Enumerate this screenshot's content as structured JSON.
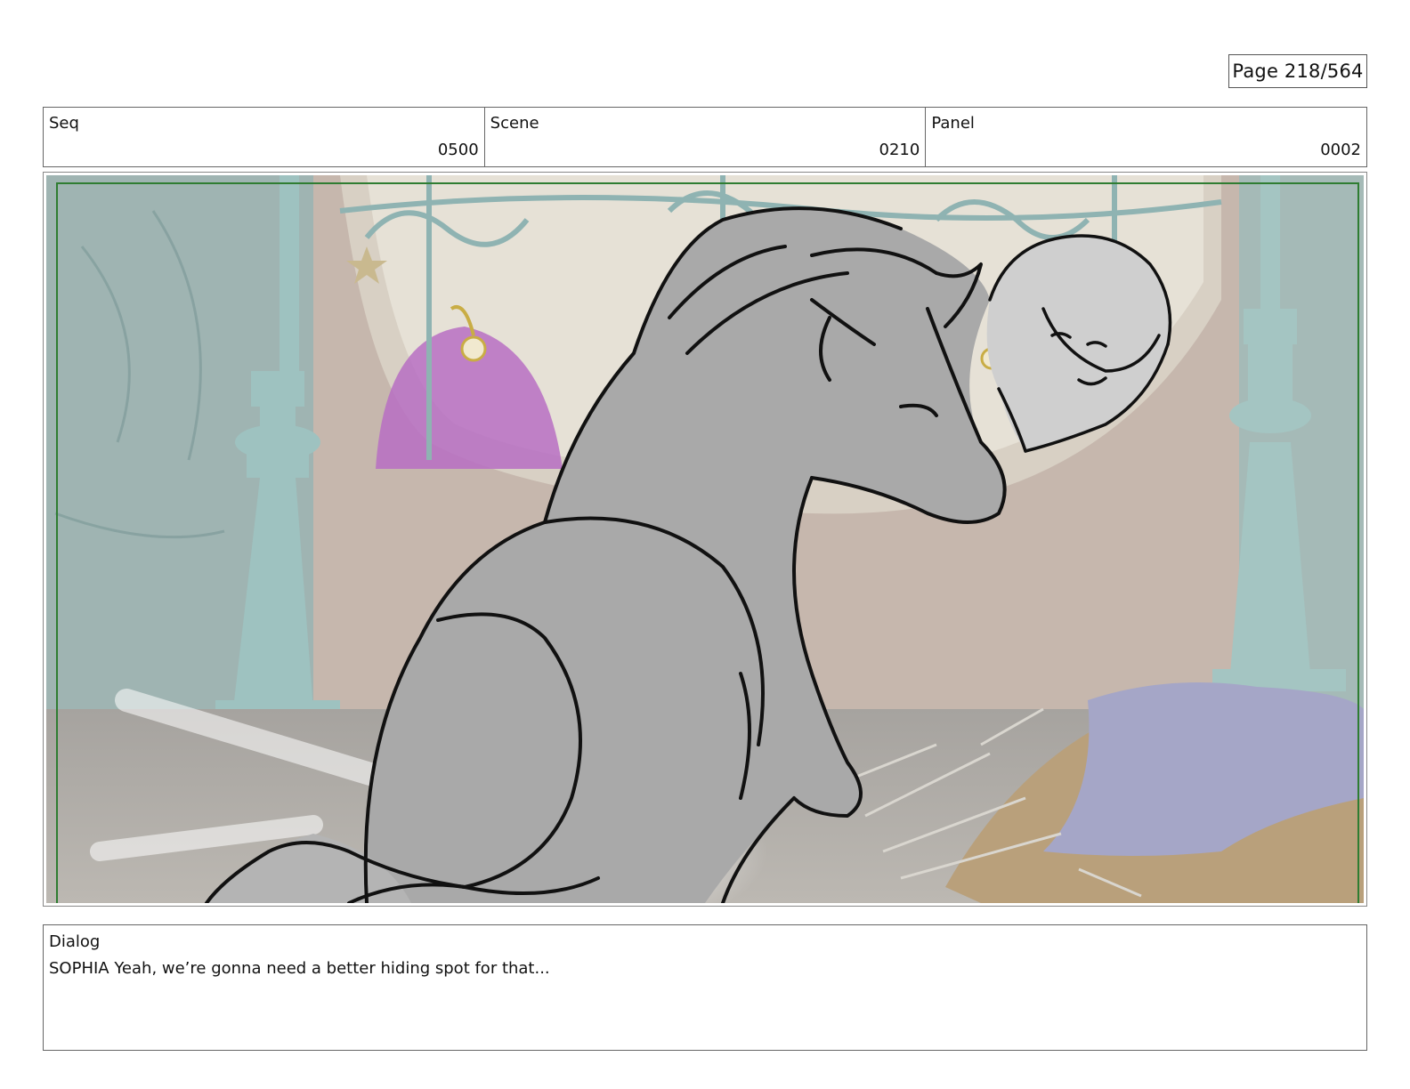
{
  "page": {
    "label": "Page 218/564"
  },
  "header": {
    "seq": {
      "label": "Seq",
      "value": "0500"
    },
    "scene": {
      "label": "Scene",
      "value": "0210"
    },
    "panel": {
      "label": "Panel",
      "value": "0002"
    }
  },
  "dialog": {
    "label": "Dialog",
    "text": "SOPHIA Yeah, we’re gonna need a better hiding spot for that..."
  },
  "colors": {
    "safe_frame": "#2f7d32",
    "border": "#666666"
  }
}
